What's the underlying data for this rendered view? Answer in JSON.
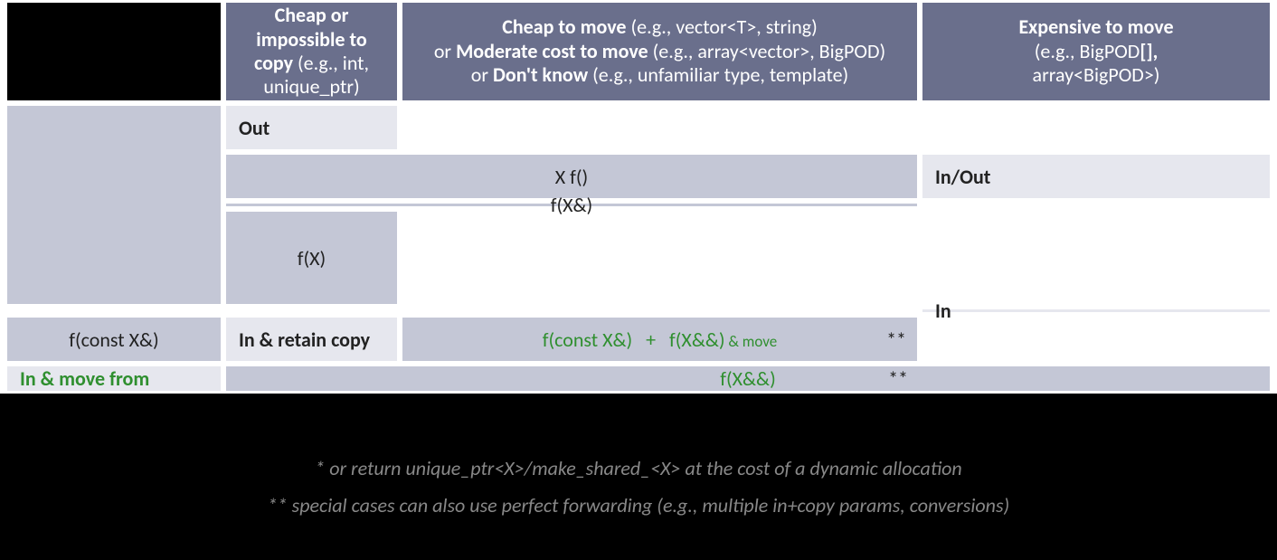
{
  "colors": {
    "header_bg": "#6a6f8c",
    "cell_bg": "#c4c7d6",
    "label_bg": "#e6e7ee",
    "green": "#2f8f2f"
  },
  "headers": {
    "col1_line1": "Cheap or",
    "col1_line2": "impossible to",
    "col1_line3_a": "copy",
    "col1_line3_b": " (e.g., int,",
    "col1_line4": "unique_ptr)",
    "col2_line1_a": "Cheap to move",
    "col2_line1_b": " (e.g., vector<T>, string)",
    "col2_line2_a": "or ",
    "col2_line2_b": "Moderate cost to move",
    "col2_line2_c": " (e.g., array<vector>, BigPOD)",
    "col2_line3_a": "or ",
    "col2_line3_b": "Don't know",
    "col2_line3_c": " (e.g., unfamiliar type, template)",
    "col3_line1": "Expensive to move",
    "col3_line2": "(e.g., BigPOD",
    "col3_line2_suffix": "[],",
    "col3_line3": "array<BigPOD>)"
  },
  "rows": {
    "out": "Out",
    "inout": "In/Out",
    "in": "In",
    "in_retain": "In & retain copy",
    "in_move": "In & move from"
  },
  "values": {
    "out": "X f()",
    "inout": "f(X&)",
    "fx": "f(X)",
    "constref": "f(const X&)",
    "retain_a": "f(const X&)",
    "retain_plus": "   +   ",
    "retain_b": "f(X&&)",
    "retain_move": " & move",
    "move_from": "f(X&&)",
    "star2": "**"
  },
  "footnotes": {
    "n1": "* or return unique_ptr<X>/make_shared_<X> at the cost of a dynamic allocation",
    "n2": "** special cases can also use perfect forwarding (e.g., multiple in+copy params, conversions)"
  }
}
